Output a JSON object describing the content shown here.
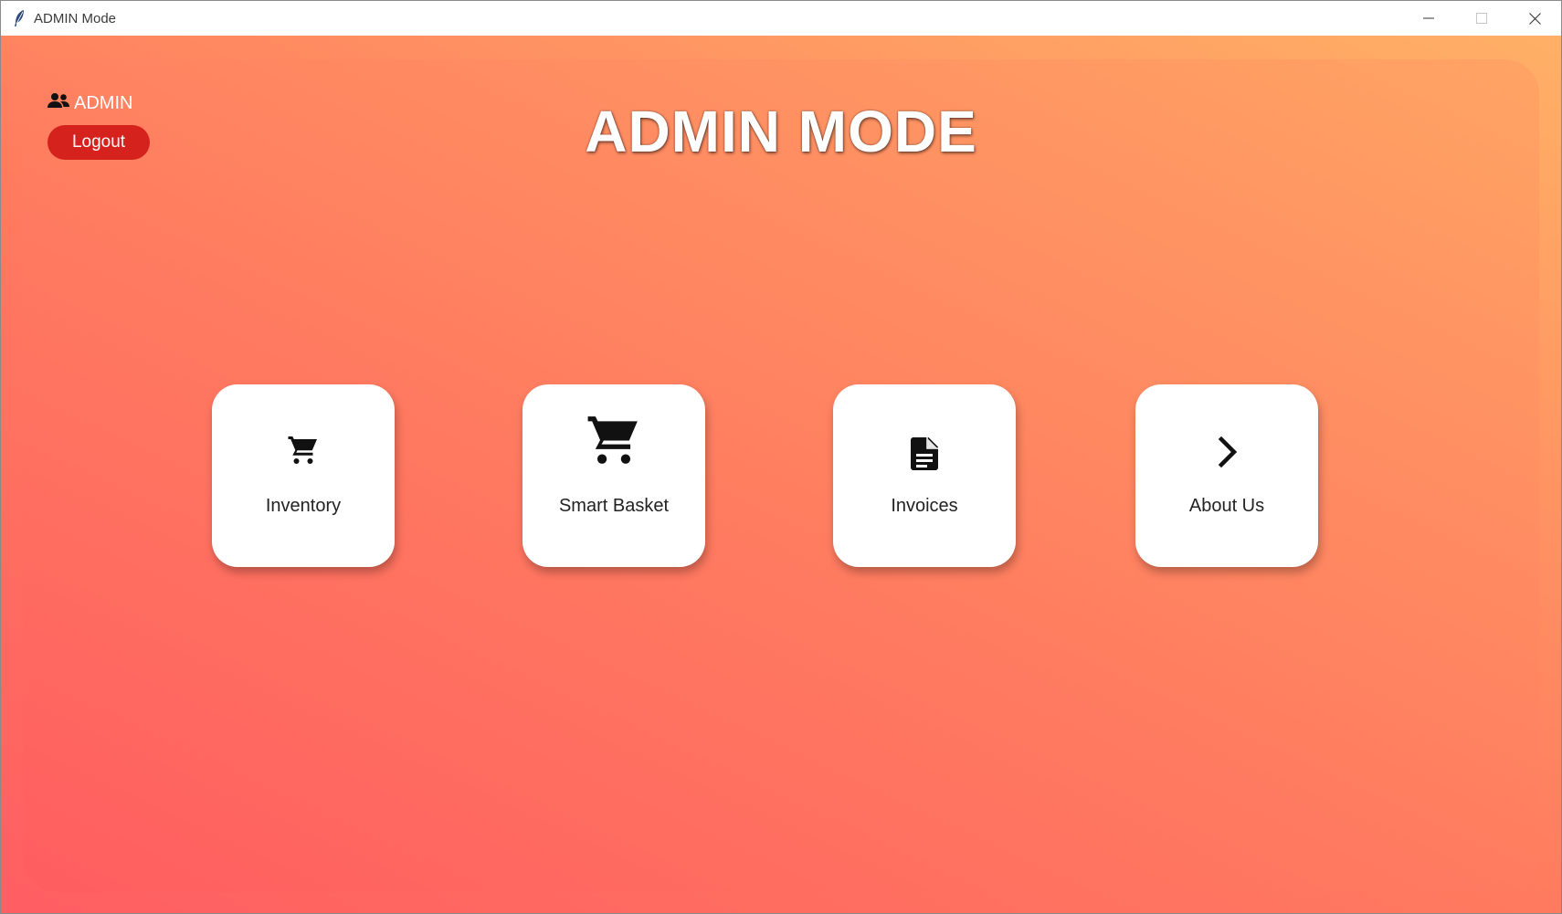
{
  "window": {
    "title": "ADMIN Mode",
    "icons": {
      "app": "feather-icon",
      "minimize": "minimize-icon",
      "maximize": "maximize-icon",
      "close": "close-icon"
    }
  },
  "header": {
    "user_label": "ADMIN",
    "user_icon": "users-icon",
    "logout_label": "Logout",
    "title": "ADMIN MODE"
  },
  "cards": [
    {
      "label": "Inventory",
      "icon": "cart-icon"
    },
    {
      "label": "Smart Basket",
      "icon": "large-cart-icon"
    },
    {
      "label": "Invoices",
      "icon": "document-icon"
    },
    {
      "label": "About Us",
      "icon": "chevron-right-icon"
    }
  ],
  "colors": {
    "gradient_start": "#ff5d60",
    "gradient_end": "#ffa464",
    "logout_button": "#d6221d",
    "card_background": "#ffffff"
  }
}
